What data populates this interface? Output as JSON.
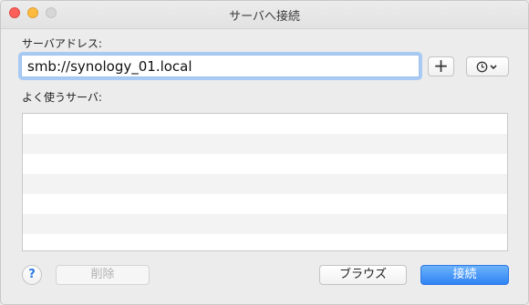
{
  "window": {
    "title": "サーバへ接続"
  },
  "server_address": {
    "label": "サーバアドレス:",
    "value": "smb://synology_01.local"
  },
  "favorites": {
    "label": "よく使うサーバ:",
    "items": []
  },
  "buttons": {
    "add": "+",
    "help": "?",
    "delete": "削除",
    "browse": "ブラウズ",
    "connect": "接続"
  },
  "icons": {
    "add": "plus-icon",
    "history": "clock-icon",
    "dropdown": "chevron-down-icon"
  },
  "colors": {
    "accent": "#2f83f5",
    "close": "#fc605b",
    "minimize": "#fdbc40"
  }
}
